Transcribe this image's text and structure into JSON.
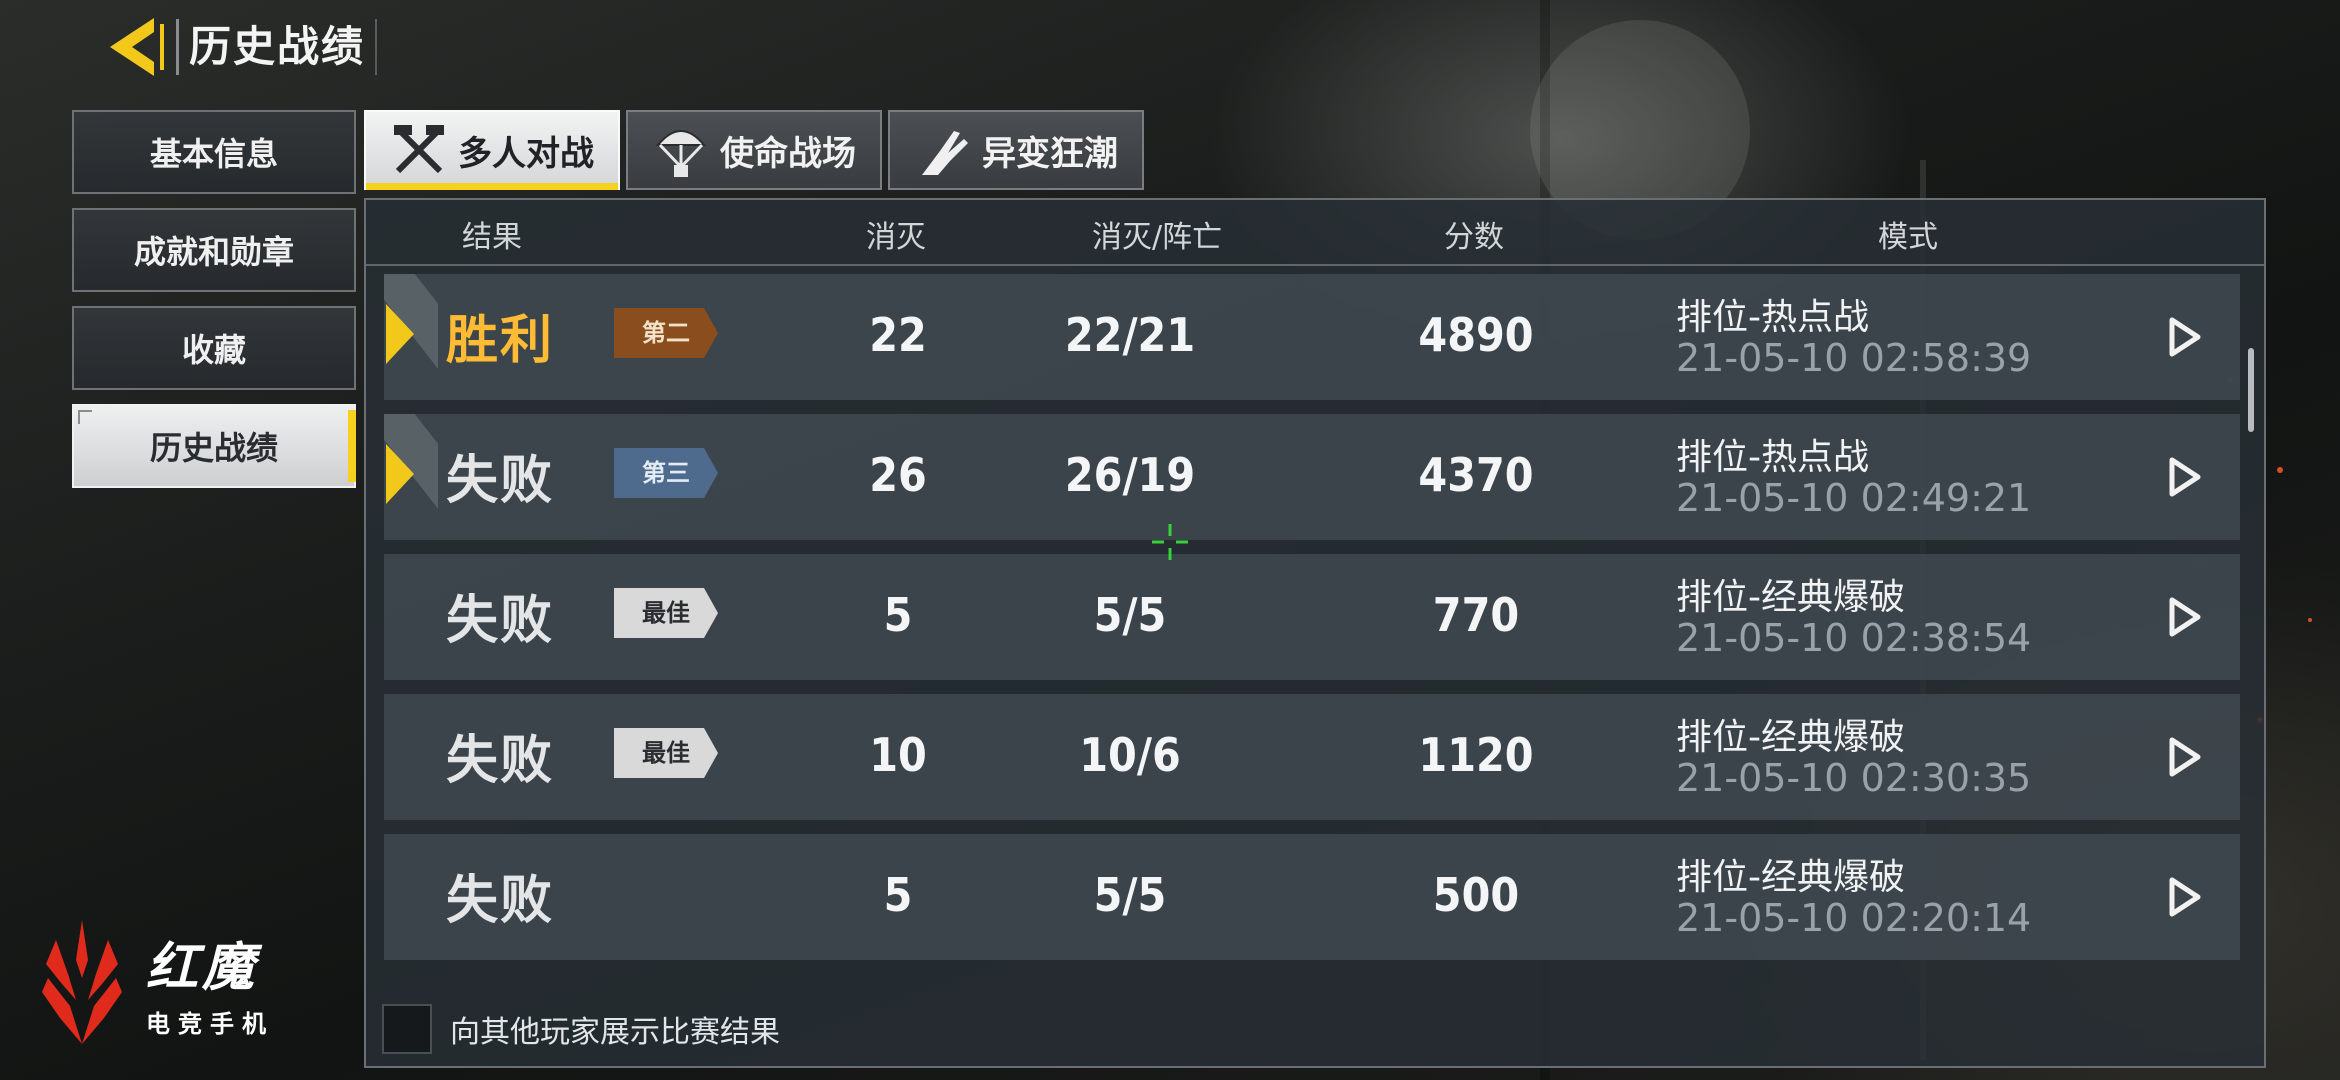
{
  "header": {
    "title": "历史战绩"
  },
  "sidebar": {
    "items": [
      {
        "label": "基本信息"
      },
      {
        "label": "成就和勋章"
      },
      {
        "label": "收藏"
      },
      {
        "label": "历史战绩"
      }
    ],
    "active_index": 3
  },
  "tabs": [
    {
      "label": "多人对战",
      "icon": "crossed-weapons-icon"
    },
    {
      "label": "使命战场",
      "icon": "parachute-icon"
    },
    {
      "label": "异变狂潮",
      "icon": "claw-icon"
    }
  ],
  "table": {
    "headers": {
      "result": "结果",
      "kills": "消灭",
      "kd": "消灭/阵亡",
      "score": "分数",
      "mode": "模式"
    },
    "rows": [
      {
        "result": "胜利",
        "badge": "第二",
        "kills": "22",
        "kd": "22/21",
        "score": "4890",
        "mode": "排位-热点战",
        "time": "21-05-10 02:58:39"
      },
      {
        "result": "失败",
        "badge": "第三",
        "kills": "26",
        "kd": "26/19",
        "score": "4370",
        "mode": "排位-热点战",
        "time": "21-05-10 02:49:21"
      },
      {
        "result": "失败",
        "badge": "最佳",
        "kills": "5",
        "kd": "5/5",
        "score": "770",
        "mode": "排位-经典爆破",
        "time": "21-05-10 02:38:54"
      },
      {
        "result": "失败",
        "badge": "最佳",
        "kills": "10",
        "kd": "10/6",
        "score": "1120",
        "mode": "排位-经典爆破",
        "time": "21-05-10 02:30:35"
      },
      {
        "result": "失败",
        "badge": "",
        "kills": "5",
        "kd": "5/5",
        "score": "500",
        "mode": "排位-经典爆破",
        "time": "21-05-10 02:20:14"
      }
    ]
  },
  "share": {
    "label": "向其他玩家展示比赛结果",
    "checked": false
  },
  "watermark": {
    "brand": "红魔",
    "subtitle": "电竞手机"
  },
  "colors": {
    "accent_yellow": "#f6d21e",
    "win_orange": "#ffbb33",
    "badge_bronze": "#8a4e1e",
    "badge_steel": "#4e6a8c",
    "badge_best": "#d9d9d9",
    "logo_red": "#e02a1c"
  }
}
